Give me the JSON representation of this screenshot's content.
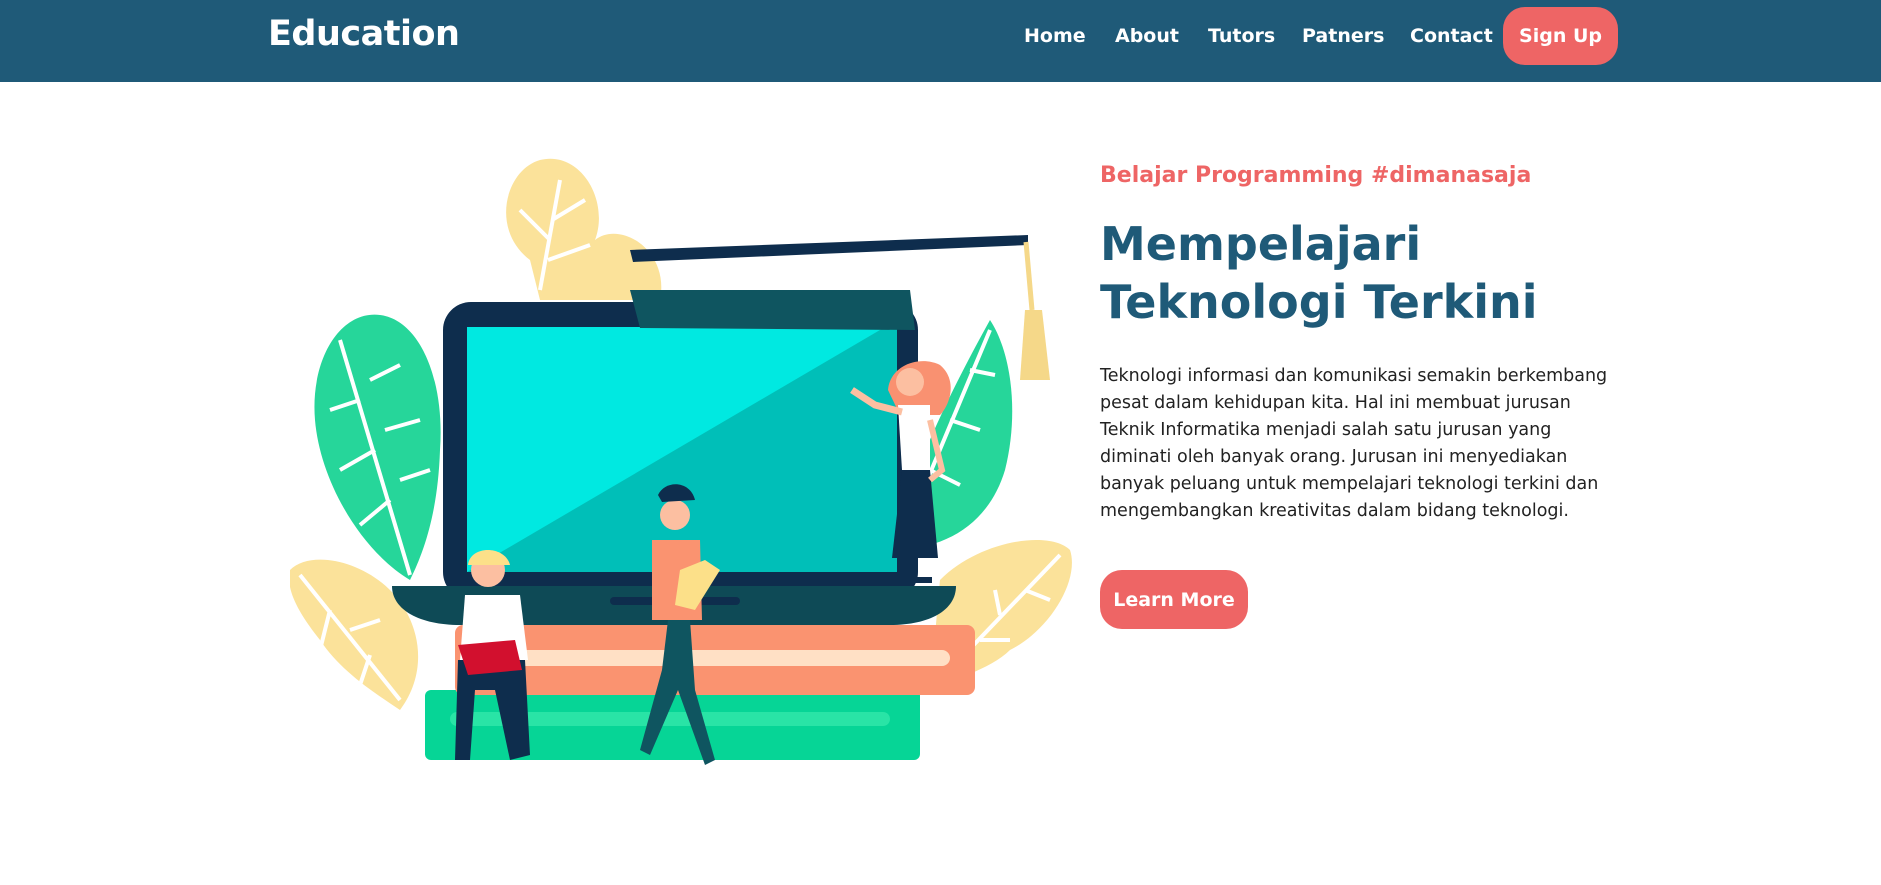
{
  "navbar": {
    "brand": "Education",
    "links": [
      "Home",
      "About",
      "Tutors",
      "Patners",
      "Contact"
    ],
    "signup_label": "Sign Up",
    "background_color": "#1f5a78"
  },
  "hero": {
    "tagline": "Belajar Programming #dimanasaja",
    "headline_line1": "Mempelajari",
    "headline_line2": "Teknologi Terkini",
    "description": "Teknologi informasi dan komunikasi semakin berkembang pesat dalam kehidupan kita. Hal ini membuat jurusan Teknik Informatika menjadi salah satu jurusan yang diminati oleh banyak orang. Jurusan ini menyediakan banyak peluang untuk mempelajari teknologi terkini dan mengembangkan kreativitas dalam bidang teknologi.",
    "cta_label": "Learn More",
    "accent_color": "#ee6565",
    "heading_color": "#1f5a78",
    "illustration": "education-laptop-illustration"
  }
}
